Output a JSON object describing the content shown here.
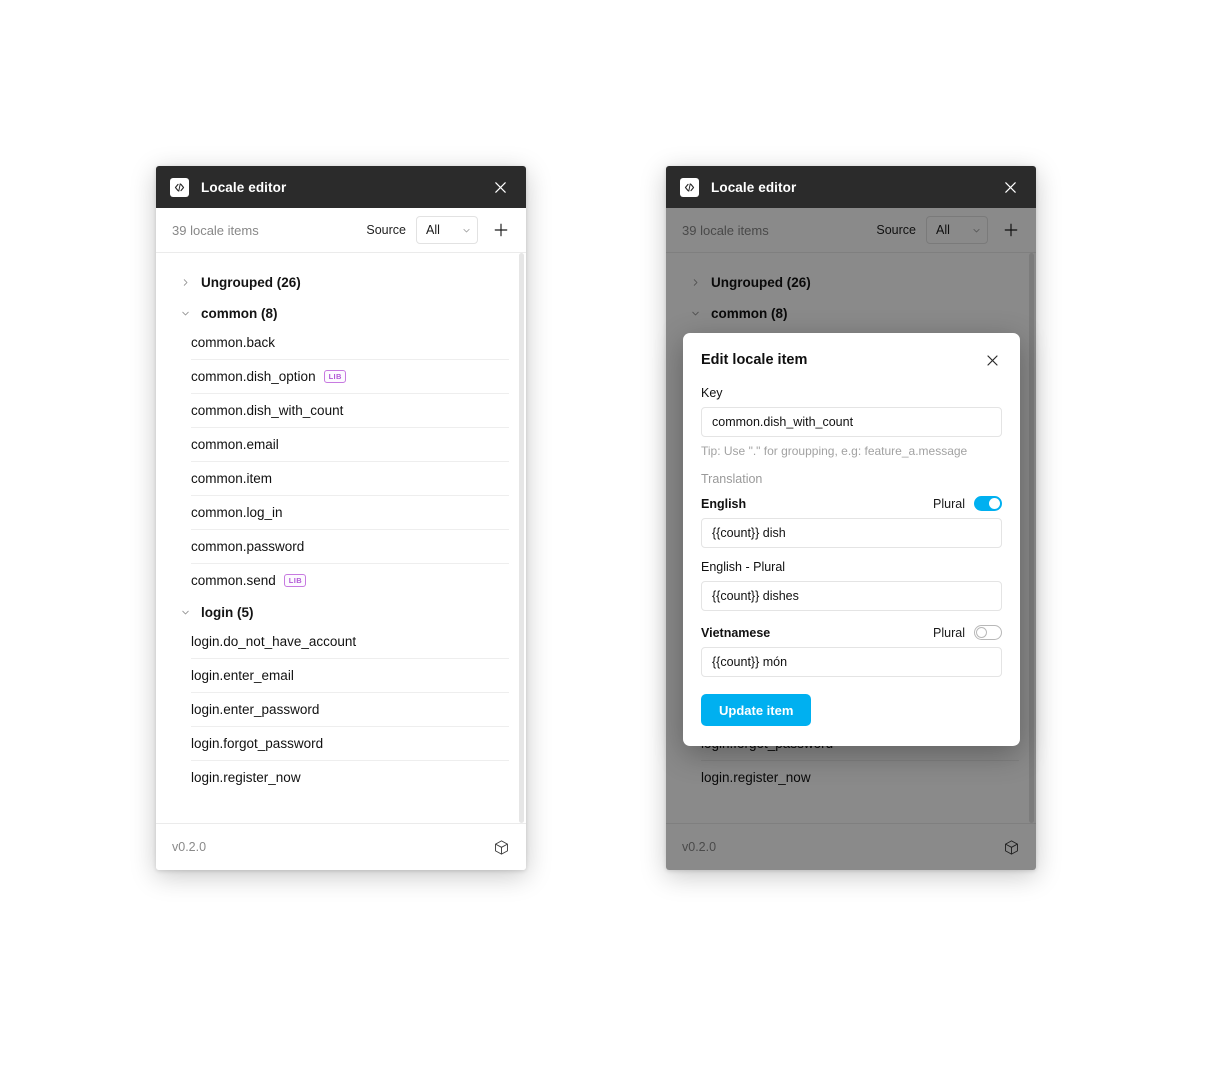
{
  "window": {
    "title": "Locale editor",
    "logo_icon": "code-brackets-icon",
    "close_icon": "close-icon"
  },
  "toolbar": {
    "item_count": "39 locale items",
    "source_label": "Source",
    "source_value": "All",
    "source_options": [
      "All"
    ],
    "add_icon": "plus-icon",
    "caret_icon": "chevron-down-icon"
  },
  "footer": {
    "version": "v0.2.0",
    "cube_icon": "cube-icon"
  },
  "list": {
    "groups": [
      {
        "label": "Ungrouped (26)",
        "expanded": false,
        "chevron": "chevron-right-icon",
        "items": []
      },
      {
        "label": "common (8)",
        "expanded": true,
        "chevron": "chevron-down-icon",
        "items": [
          {
            "key": "common.back",
            "badge": null
          },
          {
            "key": "common.dish_option",
            "badge": "LIB"
          },
          {
            "key": "common.dish_with_count",
            "badge": null
          },
          {
            "key": "common.email",
            "badge": null
          },
          {
            "key": "common.item",
            "badge": null
          },
          {
            "key": "common.log_in",
            "badge": null
          },
          {
            "key": "common.password",
            "badge": null
          },
          {
            "key": "common.send",
            "badge": "LIB"
          }
        ]
      },
      {
        "label": "login (5)",
        "expanded": true,
        "chevron": "chevron-down-icon",
        "items": [
          {
            "key": "login.do_not_have_account",
            "badge": null
          },
          {
            "key": "login.enter_email",
            "badge": null
          },
          {
            "key": "login.enter_password",
            "badge": null
          },
          {
            "key": "login.forgot_password",
            "badge": null
          },
          {
            "key": "login.register_now",
            "badge": null
          }
        ]
      }
    ]
  },
  "modal": {
    "title": "Edit locale item",
    "close_icon": "close-icon",
    "key_label": "Key",
    "key_value": "common.dish_with_count",
    "tip": "Tip: Use \".\" for groupping, e.g: feature_a.message",
    "translation_label": "Translation",
    "plural_label": "Plural",
    "translations": [
      {
        "language": "English",
        "plural_on": true,
        "value": "{{count}} dish",
        "plural_field_label": "English - Plural",
        "plural_value": "{{count}} dishes"
      },
      {
        "language": "Vietnamese",
        "plural_on": false,
        "value": "{{count}} món"
      }
    ],
    "submit_label": "Update item"
  },
  "colors": {
    "accent": "#00b0f0",
    "titlebar": "#2b2b2b",
    "badge": "#b25ad6"
  }
}
